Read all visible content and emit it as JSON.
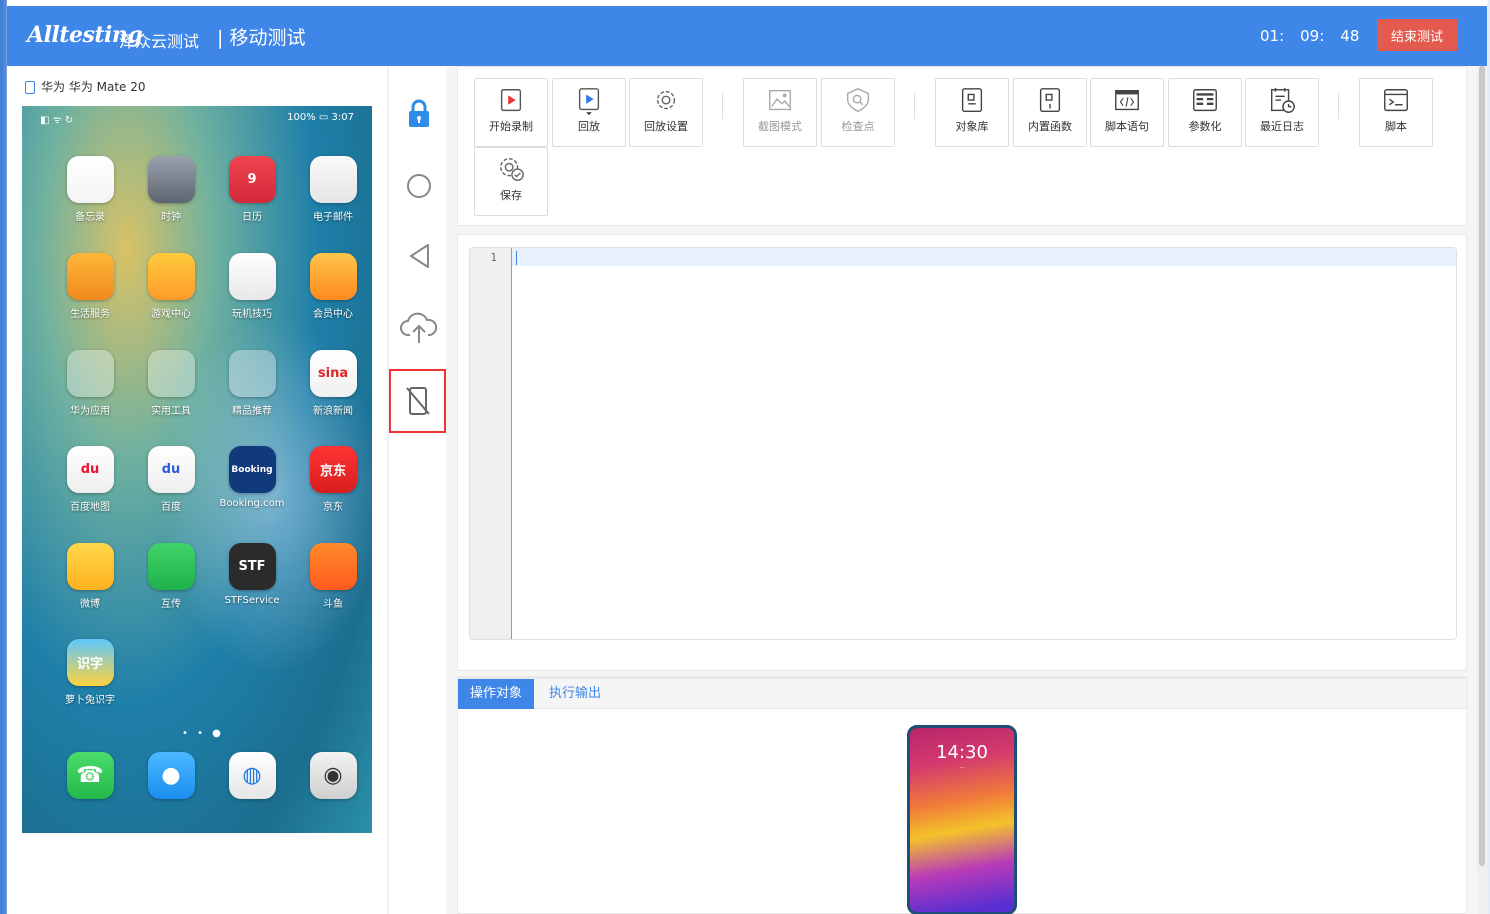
{
  "header": {
    "logo": "Alltesting",
    "logo_cn": "泽众云测试",
    "title": "| 移动测试",
    "timer": {
      "h": "01:",
      "m": "09:",
      "s": "48"
    },
    "end_button": "结束测试"
  },
  "device": {
    "label": "华为 华为 Mate 20",
    "status_left": "◧ ᯤ ↻",
    "status_right": "100% ▭ 3:07",
    "page_dots": "• • ●",
    "apps": [
      {
        "label": "备忘录",
        "icon": "memo-icon"
      },
      {
        "label": "时钟",
        "icon": "clock-icon"
      },
      {
        "label": "日历",
        "icon": "calendar-icon",
        "text": "9"
      },
      {
        "label": "电子邮件",
        "icon": "mail-icon"
      },
      {
        "label": "生活服务",
        "icon": "cup-icon"
      },
      {
        "label": "游戏中心",
        "icon": "gamepad-icon"
      },
      {
        "label": "玩机技巧",
        "icon": "tips-icon"
      },
      {
        "label": "会员中心",
        "icon": "diamond-icon"
      },
      {
        "label": "华为应用",
        "icon": "folder-icon"
      },
      {
        "label": "实用工具",
        "icon": "folder-icon"
      },
      {
        "label": "精品推荐",
        "icon": "folder-icon"
      },
      {
        "label": "新浪新闻",
        "icon": "sina-icon",
        "text": "sina"
      },
      {
        "label": "百度地图",
        "icon": "baidu-map-icon",
        "text": "du"
      },
      {
        "label": "百度",
        "icon": "baidu-icon",
        "text": "du"
      },
      {
        "label": "Booking.com",
        "icon": "booking-icon",
        "text": "Booking"
      },
      {
        "label": "京东",
        "icon": "jd-icon",
        "text": "京东"
      },
      {
        "label": "微博",
        "icon": "weibo-icon"
      },
      {
        "label": "互传",
        "icon": "transfer-icon"
      },
      {
        "label": "STFService",
        "icon": "stf-icon",
        "text": "STF"
      },
      {
        "label": "斗鱼",
        "icon": "douyu-icon"
      },
      {
        "label": "萝卜兔识字",
        "icon": "rabbit-icon",
        "text": "识字"
      }
    ],
    "dock": [
      {
        "icon": "phone-icon"
      },
      {
        "icon": "messages-icon"
      },
      {
        "icon": "browser-icon"
      },
      {
        "icon": "camera-icon"
      }
    ]
  },
  "toolbar": {
    "buttons": [
      {
        "label": "开始录制",
        "icon": "record-icon"
      },
      {
        "label": "回放",
        "icon": "playback-icon"
      },
      {
        "label": "回放设置",
        "icon": "settings-icon"
      },
      {
        "label": "截图模式",
        "icon": "screenshot-icon"
      },
      {
        "label": "检查点",
        "icon": "checkpoint-icon"
      },
      {
        "label": "对象库",
        "icon": "object-library-icon"
      },
      {
        "label": "内置函数",
        "icon": "builtin-function-icon"
      },
      {
        "label": "脚本语句",
        "icon": "script-statement-icon"
      },
      {
        "label": "参数化",
        "icon": "parameterize-icon"
      },
      {
        "label": "最近日志",
        "icon": "recent-log-icon"
      },
      {
        "label": "脚本",
        "icon": "script-icon"
      },
      {
        "label": "保存",
        "icon": "save-icon"
      }
    ]
  },
  "editor": {
    "line_number": "1"
  },
  "bottom": {
    "tabs": [
      "操作对象",
      "执行输出"
    ],
    "preview_time": "14:30",
    "preview_date": "..."
  },
  "colors": {
    "brand": "#3f86e9",
    "danger": "#e55a4e"
  }
}
